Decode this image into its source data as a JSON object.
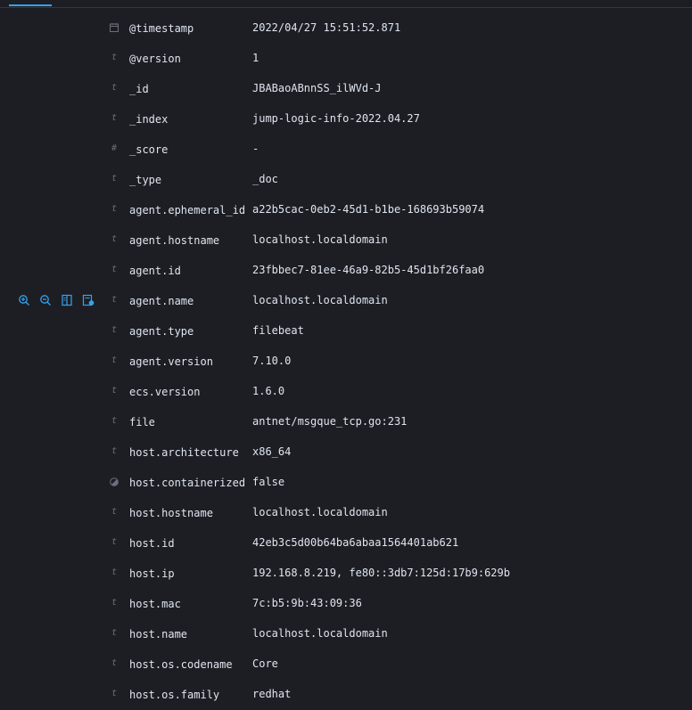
{
  "colors": {
    "background": "#1d1e24",
    "text": "#dfe5ef",
    "muted": "#69707d",
    "accent": "#36a2ef"
  },
  "row_actions": [
    "zoom-in-icon",
    "zoom-out-icon",
    "toggle-column-icon",
    "filter-exists-icon"
  ],
  "fields": [
    {
      "type": "date",
      "icon": "calendar-icon",
      "glyph": "",
      "name": "@timestamp",
      "value": "2022/04/27 15:51:52.871"
    },
    {
      "type": "string",
      "icon": "string-type-icon",
      "glyph": "t",
      "name": "@version",
      "value": "1"
    },
    {
      "type": "string",
      "icon": "string-type-icon",
      "glyph": "t",
      "name": "_id",
      "value": "JBABaoABnnSS_ilWVd-J"
    },
    {
      "type": "string",
      "icon": "string-type-icon",
      "glyph": "t",
      "name": "_index",
      "value": "jump-logic-info-2022.04.27"
    },
    {
      "type": "number",
      "icon": "number-type-icon",
      "glyph": "#",
      "name": "_score",
      "value": " -"
    },
    {
      "type": "string",
      "icon": "string-type-icon",
      "glyph": "t",
      "name": "_type",
      "value": "_doc"
    },
    {
      "type": "string",
      "icon": "string-type-icon",
      "glyph": "t",
      "name": "agent.ephemeral_id",
      "value": "a22b5cac-0eb2-45d1-b1be-168693b59074"
    },
    {
      "type": "string",
      "icon": "string-type-icon",
      "glyph": "t",
      "name": "agent.hostname",
      "value": "localhost.localdomain"
    },
    {
      "type": "string",
      "icon": "string-type-icon",
      "glyph": "t",
      "name": "agent.id",
      "value": "23fbbec7-81ee-46a9-82b5-45d1bf26faa0"
    },
    {
      "type": "string",
      "icon": "string-type-icon",
      "glyph": "t",
      "name": "agent.name",
      "value": "localhost.localdomain"
    },
    {
      "type": "string",
      "icon": "string-type-icon",
      "glyph": "t",
      "name": "agent.type",
      "value": "filebeat"
    },
    {
      "type": "string",
      "icon": "string-type-icon",
      "glyph": "t",
      "name": "agent.version",
      "value": "7.10.0"
    },
    {
      "type": "string",
      "icon": "string-type-icon",
      "glyph": "t",
      "name": "ecs.version",
      "value": "1.6.0"
    },
    {
      "type": "string",
      "icon": "string-type-icon",
      "glyph": "t",
      "name": "file",
      "value": "antnet/msgque_tcp.go:231"
    },
    {
      "type": "string",
      "icon": "string-type-icon",
      "glyph": "t",
      "name": "host.architecture",
      "value": "x86_64"
    },
    {
      "type": "boolean",
      "icon": "boolean-type-icon",
      "glyph": "",
      "name": "host.containerized",
      "value": "false"
    },
    {
      "type": "string",
      "icon": "string-type-icon",
      "glyph": "t",
      "name": "host.hostname",
      "value": "localhost.localdomain"
    },
    {
      "type": "string",
      "icon": "string-type-icon",
      "glyph": "t",
      "name": "host.id",
      "value": "42eb3c5d00b64ba6abaa1564401ab621"
    },
    {
      "type": "string",
      "icon": "string-type-icon",
      "glyph": "t",
      "name": "host.ip",
      "value": "192.168.8.219, fe80::3db7:125d:17b9:629b"
    },
    {
      "type": "string",
      "icon": "string-type-icon",
      "glyph": "t",
      "name": "host.mac",
      "value": "7c:b5:9b:43:09:36"
    },
    {
      "type": "string",
      "icon": "string-type-icon",
      "glyph": "t",
      "name": "host.name",
      "value": "localhost.localdomain"
    },
    {
      "type": "string",
      "icon": "string-type-icon",
      "glyph": "t",
      "name": "host.os.codename",
      "value": "Core"
    },
    {
      "type": "string",
      "icon": "string-type-icon",
      "glyph": "t",
      "name": "host.os.family",
      "value": "redhat"
    }
  ],
  "hover_row_index": 9
}
